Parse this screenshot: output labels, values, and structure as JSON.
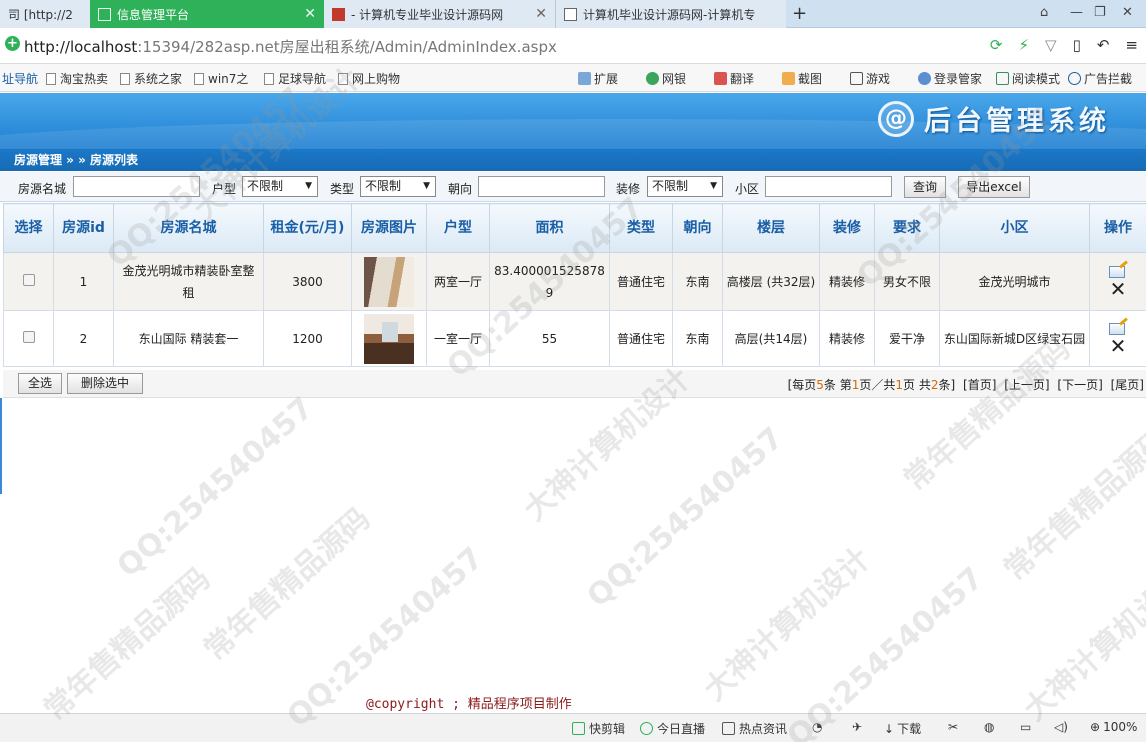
{
  "browser": {
    "tabs": [
      {
        "label": "司 [http://2",
        "active": false
      },
      {
        "label": "信息管理平台",
        "active": true
      },
      {
        "label": "- 计算机专业毕业设计源码网",
        "active": false
      },
      {
        "label": "计算机毕业设计源码网-计算机专",
        "active": false
      }
    ],
    "url_host": "http://localhost",
    "url_rest": ":15394/282asp.net房屋出租系统/Admin/AdminIndex.aspx",
    "favorites": [
      "址导航",
      "淘宝热卖",
      "系统之家",
      "win7之",
      "足球导航",
      "网上购物"
    ],
    "extensions": [
      "扩展",
      "网银",
      "翻译",
      "截图",
      "游戏",
      "登录管家",
      "阅读模式",
      "广告拦截"
    ]
  },
  "app": {
    "title": "后台管理系统",
    "logo_symbol": "@",
    "breadcrumb": "房源管理 » » 房源列表"
  },
  "search": {
    "name_label": "房源名城",
    "name_value": "",
    "layout_label": "户型",
    "layout_value": "不限制",
    "type_label": "类型",
    "type_value": "不限制",
    "orientation_label": "朝向",
    "orientation_value": "",
    "decoration_label": "装修",
    "decoration_value": "不限制",
    "community_label": "小区",
    "community_value": "",
    "query_button": "查询",
    "export_button": "导出excel"
  },
  "table": {
    "headers": [
      "选择",
      "房源id",
      "房源名城",
      "租金(元/月)",
      "房源图片",
      "户型",
      "面积",
      "类型",
      "朝向",
      "楼层",
      "装修",
      "要求",
      "小区",
      "操作"
    ],
    "rows": [
      {
        "id": "1",
        "name": "金茂光明城市精装卧室整租",
        "rent": "3800",
        "layout": "两室一厅",
        "area": "83.4000015258789",
        "type": "普通住宅",
        "orientation": "东南",
        "floor": "高楼层 (共32层)",
        "decoration": "精装修",
        "requirement": "男女不限",
        "community": "金茂光明城市"
      },
      {
        "id": "2",
        "name": "东山国际 精装套一",
        "rent": "1200",
        "layout": "一室一厅",
        "area": "55",
        "type": "普通住宅",
        "orientation": "东南",
        "floor": "高层(共14层)",
        "decoration": "精装修",
        "requirement": "爱干净",
        "community": "东山国际新城D区绿宝石园"
      }
    ]
  },
  "actions": {
    "select_all": "全选",
    "delete_selected": "删除选中"
  },
  "pager": {
    "prefix": "[每页",
    "per_page": "5",
    "mid1": "条 第",
    "current": "1",
    "mid2": "页／共",
    "pages": "1",
    "mid3": "页 共",
    "total": "2",
    "suffix": "条]",
    "first": "[首页]",
    "prev": "[上一页]",
    "next": "[下一页]",
    "last": "[尾页]"
  },
  "copyright": "@copyright ; 精品程序项目制作",
  "statusbar": [
    "快剪辑",
    "今日直播",
    "热点资讯",
    "下载",
    "100%"
  ],
  "watermarks": [
    "QQ:254540457",
    "常年售精品源码",
    "大神计算机设计"
  ]
}
